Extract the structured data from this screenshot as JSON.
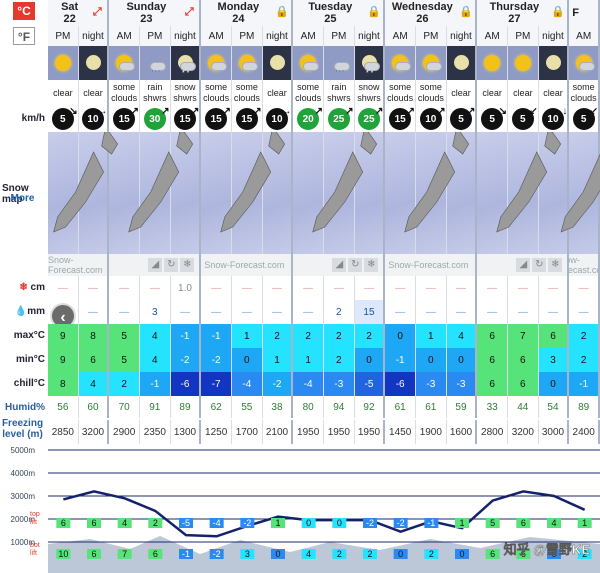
{
  "units": {
    "celsius": "°C",
    "fahrenheit": "°F"
  },
  "days": [
    {
      "name": "Sat",
      "date": "22",
      "badge": "expand-icon",
      "span": 2
    },
    {
      "name": "Sunday",
      "date": "23",
      "badge": "expand-icon",
      "span": 3
    },
    {
      "name": "Monday",
      "date": "24",
      "badge": "lock-icon",
      "span": 3
    },
    {
      "name": "Tuesday",
      "date": "25",
      "badge": "lock-icon",
      "span": 3
    },
    {
      "name": "Wednesday",
      "date": "26",
      "badge": "lock-icon",
      "span": 3
    },
    {
      "name": "Thursday",
      "date": "27",
      "badge": "lock-icon",
      "span": 3
    },
    {
      "name": "F",
      "date": "",
      "badge": "",
      "span": 1
    }
  ],
  "periods": [
    "PM",
    "night",
    "AM",
    "PM",
    "night",
    "AM",
    "PM",
    "night",
    "AM",
    "PM",
    "night",
    "AM",
    "PM",
    "night",
    "AM",
    "PM",
    "night",
    "AM"
  ],
  "weather": [
    {
      "icon": "sun",
      "l1": "clear",
      "l2": ""
    },
    {
      "icon": "moon",
      "l1": "clear",
      "l2": ""
    },
    {
      "icon": "sun-cloud",
      "l1": "some",
      "l2": "clouds"
    },
    {
      "icon": "cloud-rain",
      "l1": "rain",
      "l2": "shwrs"
    },
    {
      "icon": "moon-snow",
      "l1": "snow",
      "l2": "shwrs"
    },
    {
      "icon": "sun-cloud",
      "l1": "some",
      "l2": "clouds"
    },
    {
      "icon": "sun-cloud",
      "l1": "some",
      "l2": "clouds"
    },
    {
      "icon": "moon",
      "l1": "clear",
      "l2": ""
    },
    {
      "icon": "sun-cloud",
      "l1": "some",
      "l2": "clouds"
    },
    {
      "icon": "cloud-rain",
      "l1": "rain",
      "l2": "shwrs"
    },
    {
      "icon": "moon-snow",
      "l1": "snow",
      "l2": "shwrs"
    },
    {
      "icon": "sun-cloud",
      "l1": "some",
      "l2": "clouds"
    },
    {
      "icon": "sun-cloud",
      "l1": "some",
      "l2": "clouds"
    },
    {
      "icon": "moon",
      "l1": "clear",
      "l2": ""
    },
    {
      "icon": "sun",
      "l1": "clear",
      "l2": ""
    },
    {
      "icon": "sun",
      "l1": "clear",
      "l2": ""
    },
    {
      "icon": "moon",
      "l1": "clear",
      "l2": ""
    },
    {
      "icon": "sun-cloud",
      "l1": "some",
      "l2": "clouds"
    }
  ],
  "wind_label": "km/h",
  "wind": [
    {
      "v": "5",
      "g": false,
      "d": "↘"
    },
    {
      "v": "10",
      "g": false,
      "d": "→"
    },
    {
      "v": "15",
      "g": false,
      "d": "↗"
    },
    {
      "v": "30",
      "g": true,
      "d": "↗"
    },
    {
      "v": "15",
      "g": false,
      "d": "↗"
    },
    {
      "v": "15",
      "g": false,
      "d": "↗"
    },
    {
      "v": "15",
      "g": false,
      "d": "↗"
    },
    {
      "v": "10",
      "g": false,
      "d": "→"
    },
    {
      "v": "20",
      "g": true,
      "d": "↗"
    },
    {
      "v": "25",
      "g": true,
      "d": "↗"
    },
    {
      "v": "25",
      "g": true,
      "d": "↗"
    },
    {
      "v": "15",
      "g": false,
      "d": "↗"
    },
    {
      "v": "10",
      "g": false,
      "d": "↗"
    },
    {
      "v": "5",
      "g": false,
      "d": "↗"
    },
    {
      "v": "5",
      "g": false,
      "d": "↘"
    },
    {
      "v": "5",
      "g": false,
      "d": "↙"
    },
    {
      "v": "10",
      "g": false,
      "d": "↓"
    },
    {
      "v": "5",
      "g": false,
      "d": "↙"
    }
  ],
  "snow_map_label": "Snow map",
  "snow_map_more": "More",
  "watermark": "Snow-Forecast.com",
  "snow_cm_label": "cm",
  "snow_cm": [
    "—",
    "—",
    "—",
    "—",
    "1.0",
    "—",
    "—",
    "—",
    "—",
    "—",
    "—",
    "—",
    "—",
    "—",
    "—",
    "—",
    "—",
    "—"
  ],
  "rain_label": "mm",
  "rain_mm": [
    "—",
    "—",
    "—",
    "3",
    "—",
    "—",
    "—",
    "—",
    "—",
    "2",
    "15",
    "—",
    "—",
    "—",
    "—",
    "—",
    "—",
    "—"
  ],
  "max_label": "max°C",
  "max": [
    "9",
    "8",
    "5",
    "4",
    "-1",
    "-1",
    "1",
    "2",
    "2",
    "2",
    "2",
    "0",
    "1",
    "4",
    "6",
    "7",
    "6",
    "2"
  ],
  "min_label": "min°C",
  "min": [
    "9",
    "6",
    "5",
    "4",
    "-2",
    "-2",
    "0",
    "1",
    "1",
    "2",
    "0",
    "-1",
    "0",
    "0",
    "6",
    "6",
    "3",
    "2"
  ],
  "chill_label": "chill°C",
  "chill": [
    "8",
    "4",
    "2",
    "-1",
    "-6",
    "-7",
    "-4",
    "-2",
    "-4",
    "-3",
    "-5",
    "-6",
    "-3",
    "-3",
    "6",
    "6",
    "0",
    "-1"
  ],
  "humid_label": "Humid%",
  "humid": [
    "56",
    "60",
    "70",
    "91",
    "89",
    "62",
    "55",
    "38",
    "80",
    "94",
    "92",
    "61",
    "61",
    "59",
    "33",
    "44",
    "54",
    "89"
  ],
  "freezing_label1": "Freezing",
  "freezing_label2": "level (m)",
  "freezing": [
    "2850",
    "3200",
    "2900",
    "2350",
    "1300",
    "1250",
    "1700",
    "2100",
    "1950",
    "1950",
    "1950",
    "1450",
    "1900",
    "1600",
    "2800",
    "3200",
    "3000",
    "2400"
  ],
  "alt_labels": [
    "5000m",
    "4000m",
    "3000m",
    "2000m",
    "1000m"
  ],
  "lift_labels": {
    "top1": "top",
    "top2": "lift",
    "bot1": "bot",
    "bot2": "lift"
  },
  "top_lift": [
    "6",
    "6",
    "4",
    "2",
    "-5",
    "-4",
    "-2",
    "1",
    "0",
    "0",
    "-2",
    "-2",
    "-1",
    "1",
    "5",
    "6",
    "4",
    "1"
  ],
  "bot_lift": [
    "10",
    "6",
    "7",
    "6",
    "-1",
    "-2",
    "3",
    "0",
    "4",
    "2",
    "2",
    "0",
    "2",
    "0",
    "6",
    "6",
    "0",
    "2"
  ],
  "credit": "知乎 @雪野KE"
}
